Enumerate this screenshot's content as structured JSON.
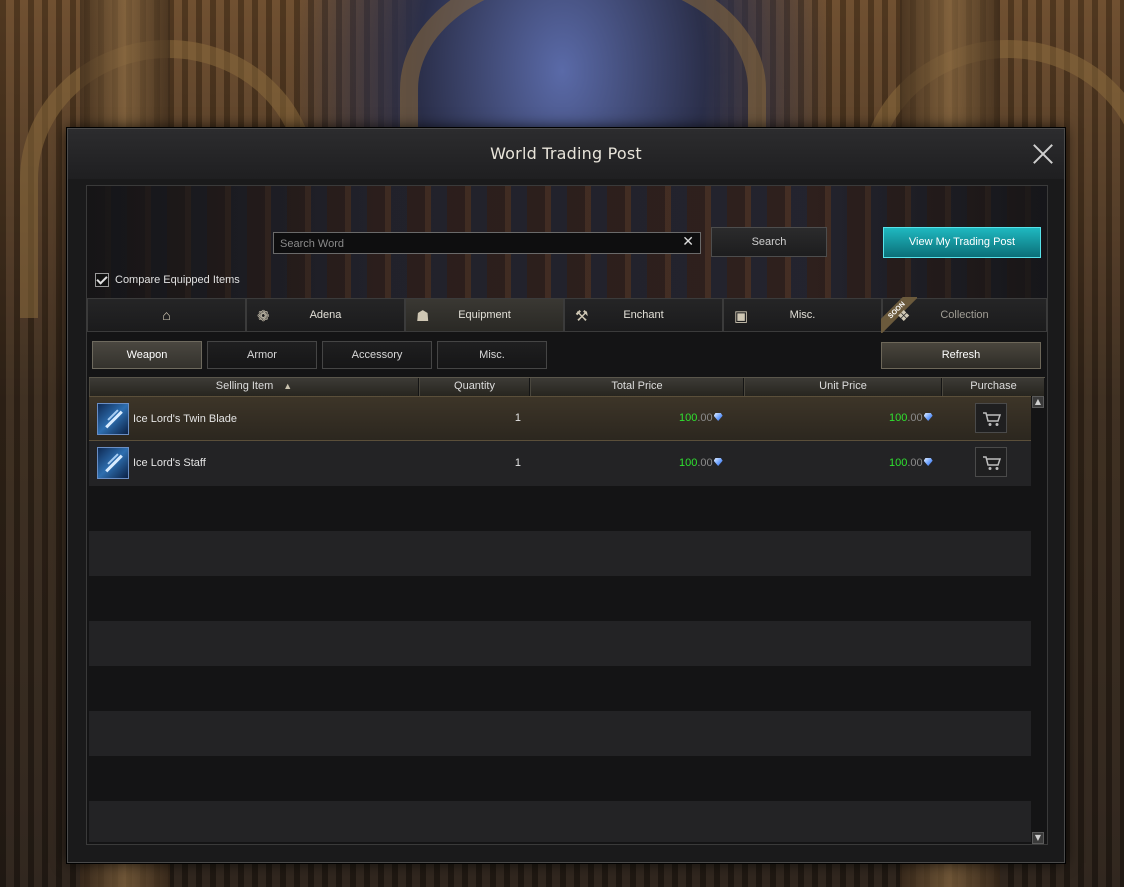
{
  "window": {
    "title": "World Trading Post"
  },
  "search": {
    "placeholder": "Search Word",
    "button_label": "Search"
  },
  "my_trading_post_label": "View My Trading Post",
  "compare_label": "Compare Equipped Items",
  "compare_checked": true,
  "tabs": [
    {
      "label": "",
      "icon": "home-icon"
    },
    {
      "label": "Adena",
      "icon": "adena-icon"
    },
    {
      "label": "Equipment",
      "icon": "helmet-icon",
      "active": true
    },
    {
      "label": "Enchant",
      "icon": "anvil-icon"
    },
    {
      "label": "Misc.",
      "icon": "box-icon"
    },
    {
      "label": "Collection",
      "icon": "collection-icon",
      "badge": "SOON",
      "disabled": true
    }
  ],
  "subtabs": [
    {
      "label": "Weapon",
      "active": true
    },
    {
      "label": "Armor"
    },
    {
      "label": "Accessory"
    },
    {
      "label": "Misc."
    }
  ],
  "refresh_label": "Refresh",
  "columns": [
    "Selling Item",
    "Quantity",
    "Total Price",
    "Unit Price",
    "Purchase"
  ],
  "items": [
    {
      "name": "Ice Lord's Twin Blade",
      "quantity": "1",
      "total_int": "100",
      "total_dec": ".00",
      "unit_int": "100",
      "unit_dec": ".00"
    },
    {
      "name": "Ice Lord's Staff",
      "quantity": "1",
      "total_int": "100",
      "total_dec": ".00",
      "unit_int": "100",
      "unit_dec": ".00"
    }
  ],
  "colors": {
    "price_green": "#2fe02f",
    "accent_teal": "#1fb8c0",
    "selected_row": "#3d3528"
  }
}
